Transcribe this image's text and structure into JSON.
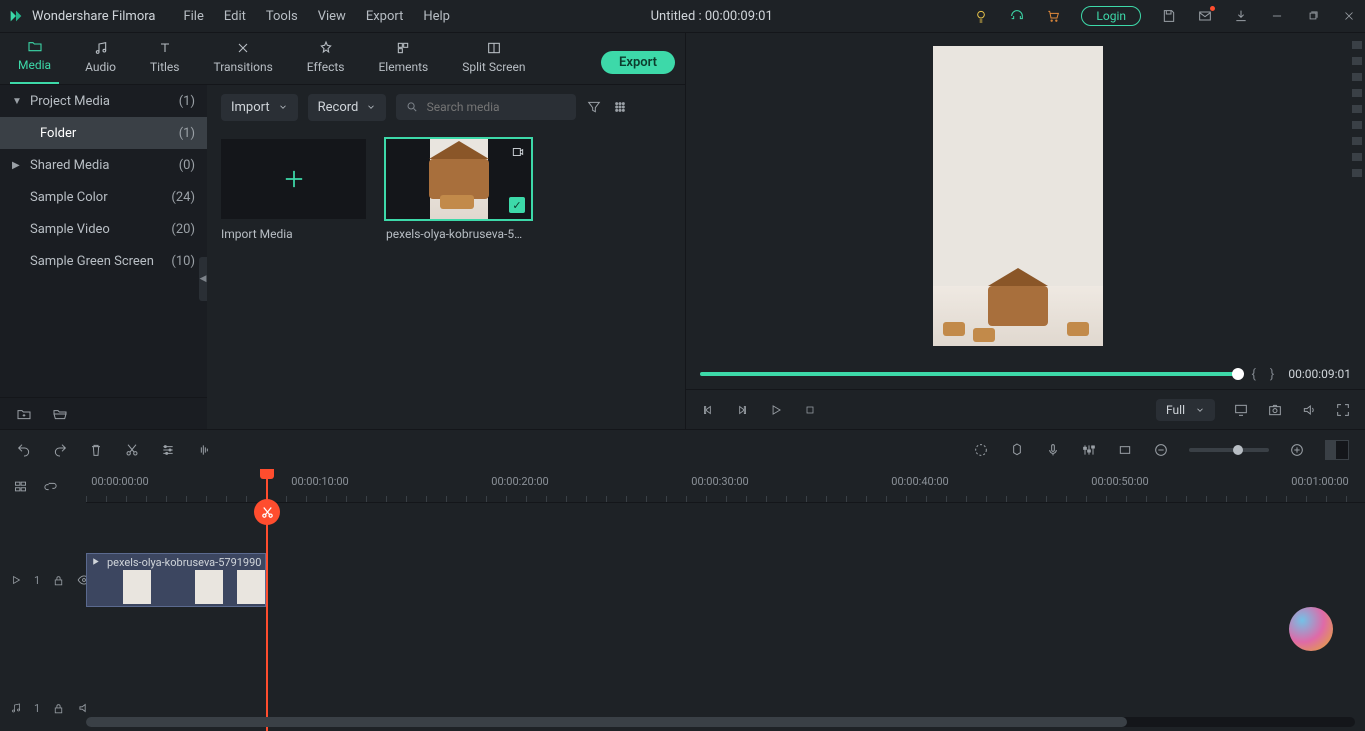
{
  "app_name": "Wondershare Filmora",
  "menu": [
    "File",
    "Edit",
    "Tools",
    "View",
    "Export",
    "Help"
  ],
  "project_title": "Untitled : 00:00:09:01",
  "login_label": "Login",
  "tabs": [
    {
      "label": "Media",
      "icon": "folder-icon"
    },
    {
      "label": "Audio",
      "icon": "music-icon"
    },
    {
      "label": "Titles",
      "icon": "text-icon"
    },
    {
      "label": "Transitions",
      "icon": "transitions-icon"
    },
    {
      "label": "Effects",
      "icon": "effects-icon"
    },
    {
      "label": "Elements",
      "icon": "elements-icon"
    },
    {
      "label": "Split Screen",
      "icon": "split-icon"
    }
  ],
  "export_label": "Export",
  "tree": [
    {
      "label": "Project Media",
      "count": "(1)",
      "expandable": true,
      "open": true
    },
    {
      "label": "Folder",
      "count": "(1)",
      "child": true,
      "active": true
    },
    {
      "label": "Shared Media",
      "count": "(0)",
      "expandable": true
    },
    {
      "label": "Sample Color",
      "count": "(24)"
    },
    {
      "label": "Sample Video",
      "count": "(20)"
    },
    {
      "label": "Sample Green Screen",
      "count": "(10)"
    }
  ],
  "import_label": "Import",
  "record_label": "Record",
  "search_placeholder": "Search media",
  "thumbs": {
    "import": "Import Media",
    "clip": "pexels-olya-kobruseva-5…"
  },
  "preview": {
    "time": "00:00:09:01",
    "mark_in": "{",
    "mark_out": "}",
    "quality": "Full"
  },
  "ruler_ticks": [
    "00:00:00:00",
    "00:00:10:00",
    "00:00:20:00",
    "00:00:30:00",
    "00:00:40:00",
    "00:00:50:00",
    "00:01:00:00"
  ],
  "track": {
    "video_index": "1",
    "audio_index": "1",
    "clip_label": "pexels-olya-kobruseva-5791990"
  }
}
